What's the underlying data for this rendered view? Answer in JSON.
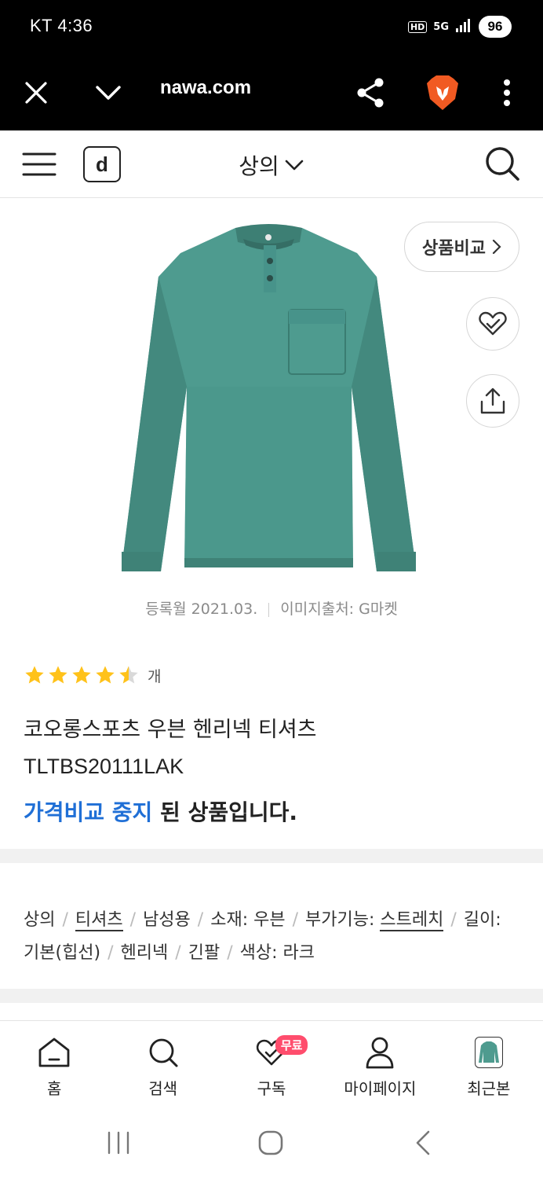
{
  "status_bar": {
    "carrier_time": "KT 4:36",
    "hd": "HD",
    "network": "5G",
    "battery": "96"
  },
  "browser": {
    "url": "nawa.com",
    "icons": [
      "close-icon",
      "chevron-down-icon",
      "share-icon",
      "brave-lion-icon",
      "more-vertical-icon"
    ]
  },
  "header": {
    "logo": "d",
    "category": "상의",
    "icons": [
      "menu-icon",
      "search-icon"
    ]
  },
  "product": {
    "compare_label": "상품비교",
    "registered": "등록월 2021.03.",
    "image_source": "이미지출처: G마켓",
    "rating_stars": 4.5,
    "rating_unit": "개",
    "title_line1": "코오롱스포츠 우븐 헨리넥 티셔츠",
    "title_line2": "TLTBS20111LAK",
    "price_note_accent": "가격비교 중지",
    "price_note_rest": " 된 상품입니다.",
    "accent_color": "#1f6fd6",
    "shirt_color": "#4e9b8f"
  },
  "specs": {
    "items": [
      "상의",
      "티셔츠",
      "남성용",
      "소재: 우븐",
      "부가기능: ",
      "스트레치",
      "길이: 기본(힙선)",
      "헨리넥",
      "긴팔",
      "색상: 라크"
    ]
  },
  "bottom_nav": {
    "items": [
      {
        "label": "홈",
        "icon": "home-icon"
      },
      {
        "label": "검색",
        "icon": "search-icon"
      },
      {
        "label": "구독",
        "icon": "subscribe-heart-icon",
        "badge": "무료"
      },
      {
        "label": "마이페이지",
        "icon": "user-icon"
      },
      {
        "label": "최근본",
        "icon": "recent-thumbnail"
      }
    ],
    "badge_color": "#ff4d6d"
  },
  "system_nav": {
    "icons": [
      "recent-apps-icon",
      "home-circle-icon",
      "back-icon"
    ]
  }
}
